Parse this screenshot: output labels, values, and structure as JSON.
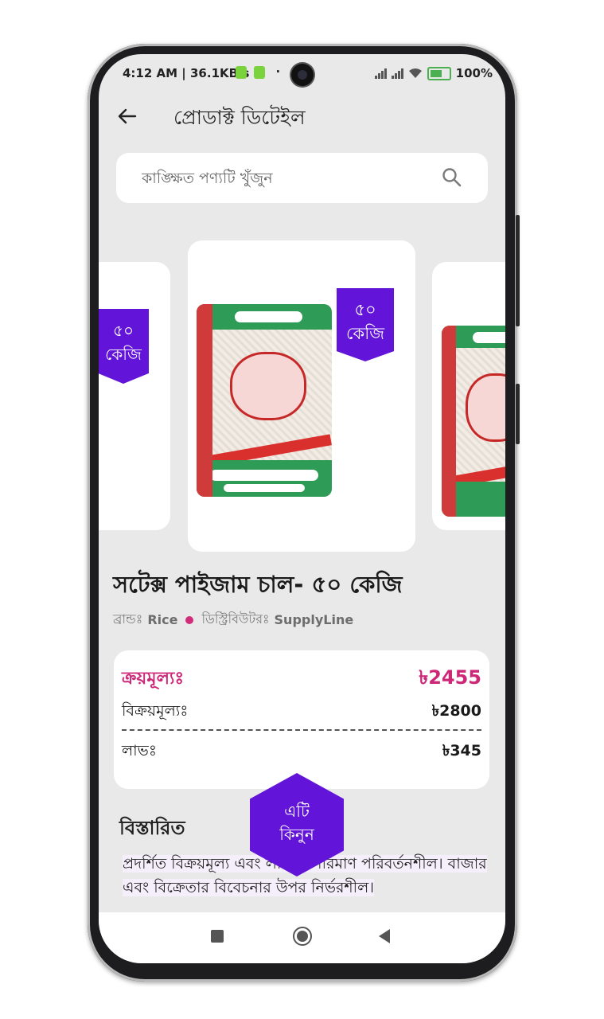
{
  "status_bar": {
    "time": "4:12 AM | 36.1KB/s",
    "dot": "·",
    "battery": "100%"
  },
  "appbar": {
    "title": "প্রোডাক্ট ডিটেইল"
  },
  "search": {
    "placeholder": "কাঙ্ক্ষিত পণ্যটি খুঁজুন"
  },
  "carousel": {
    "badge_line1": "৫০",
    "badge_line2": "কেজি"
  },
  "product": {
    "title": "সটেক্স  পাইজাম চাল- ৫০ কেজি",
    "brand_label": "ব্রান্ডঃ",
    "brand": "Rice",
    "distributor_label": "ডিস্ট্রিবিউটরঃ",
    "distributor": "SupplyLine"
  },
  "pricing": {
    "purchase_label": "ক্রয়মূল্যঃ",
    "purchase_value": "৳2455",
    "sale_label": "বিক্রয়মূল্যঃ",
    "sale_value": "৳2800",
    "profit_label": "লাভঃ",
    "profit_value": "৳345"
  },
  "details": {
    "heading": "বিস্তারিত",
    "text": "প্রদর্শিত বিক্রয়মূল্য এবং লাভের পরিমাণ পরিবর্তনশীল। বাজার এবং বিক্রেতার বিবেচনার উপর নির্ভরশীল।"
  },
  "buy_button": {
    "line1": "এটি",
    "line2": "কিনুন"
  },
  "colors": {
    "accent": "#6214d9",
    "price": "#cc2877"
  }
}
